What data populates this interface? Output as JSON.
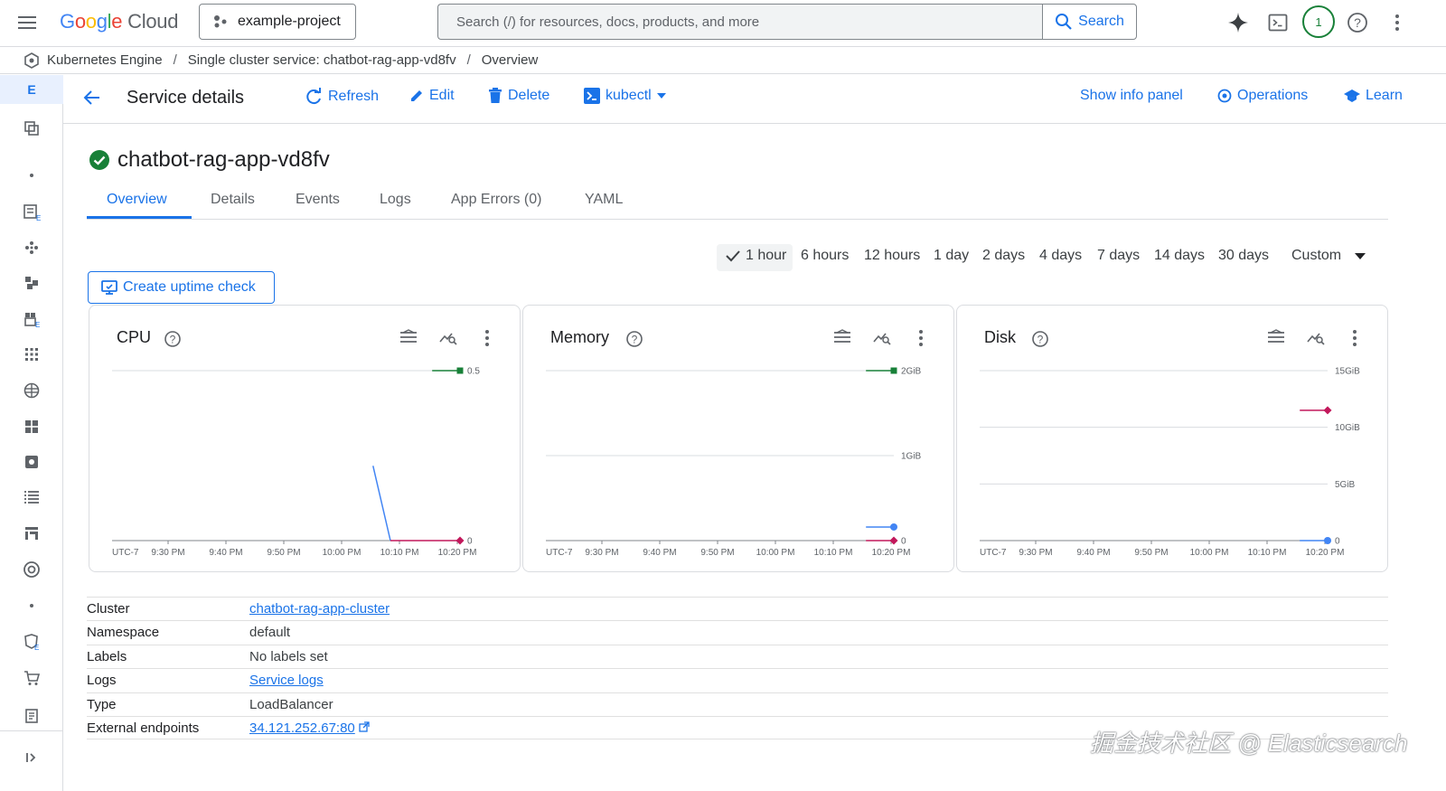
{
  "brand": {
    "logo_letters": [
      "G",
      "o",
      "o",
      "g",
      "l",
      "e"
    ],
    "product": "Cloud"
  },
  "project": {
    "name": "example-project"
  },
  "search": {
    "placeholder": "Search (/) for resources, docs, products, and more",
    "button_label": "Search"
  },
  "account": {
    "avatar_text": "1"
  },
  "breadcrumb": {
    "items": [
      "Kubernetes Engine",
      "Single cluster service:  chatbot-rag-app-vd8fv",
      "Overview"
    ],
    "separator": "/"
  },
  "rail": {
    "active_label": "E"
  },
  "actionbar": {
    "title": "Service details",
    "refresh": "Refresh",
    "edit": "Edit",
    "delete": "Delete",
    "kubectl": "kubectl",
    "show_info_panel": "Show info panel",
    "operations": "Operations",
    "learn": "Learn"
  },
  "service": {
    "name": "chatbot-rag-app-vd8fv",
    "status": "ok"
  },
  "tabs": [
    "Overview",
    "Details",
    "Events",
    "Logs",
    "App Errors (0)",
    "YAML"
  ],
  "time_range": {
    "options": [
      "1 hour",
      "6 hours",
      "12 hours",
      "1 day",
      "2 days",
      "4 days",
      "7 days",
      "14 days",
      "30 days"
    ],
    "custom": "Custom",
    "selected": "1 hour"
  },
  "uptime_button": "Create uptime check",
  "charts_meta": {
    "x_ticks": [
      "UTC-7",
      "9:30 PM",
      "9:40 PM",
      "9:50 PM",
      "10:00 PM",
      "10:10 PM",
      "10:20 PM"
    ]
  },
  "chart_data": [
    {
      "type": "line",
      "title": "CPU",
      "y_ticks": [
        "0.5",
        "0"
      ],
      "ylim": [
        0,
        0.5
      ],
      "series": [
        {
          "color": "#188038",
          "values": [
            [
              0.92,
              0.5
            ],
            [
              1.0,
              0.5
            ]
          ],
          "end_marker": "square"
        },
        {
          "color": "#4285f4",
          "values": [
            [
              0.75,
              0.22
            ],
            [
              0.8,
              0.0
            ]
          ],
          "end_marker": "none"
        },
        {
          "color": "#c2185b",
          "values": [
            [
              0.8,
              0.0
            ],
            [
              1.0,
              0.0
            ]
          ],
          "end_marker": "diamond"
        }
      ]
    },
    {
      "type": "line",
      "title": "Memory",
      "y_ticks": [
        "2GiB",
        "1GiB",
        "0"
      ],
      "ylim": [
        0,
        2
      ],
      "series": [
        {
          "color": "#188038",
          "values": [
            [
              0.92,
              2.0
            ],
            [
              1.0,
              2.0
            ]
          ],
          "end_marker": "square"
        },
        {
          "color": "#4285f4",
          "values": [
            [
              0.92,
              0.16
            ],
            [
              1.0,
              0.16
            ]
          ],
          "end_marker": "circle"
        },
        {
          "color": "#c2185b",
          "values": [
            [
              0.92,
              0.0
            ],
            [
              1.0,
              0.0
            ]
          ],
          "end_marker": "diamond"
        }
      ]
    },
    {
      "type": "line",
      "title": "Disk",
      "y_ticks": [
        "15GiB",
        "10GiB",
        "5GiB",
        "0"
      ],
      "ylim": [
        0,
        15
      ],
      "series": [
        {
          "color": "#c2185b",
          "values": [
            [
              0.92,
              11.5
            ],
            [
              1.0,
              11.5
            ]
          ],
          "end_marker": "diamond"
        },
        {
          "color": "#4285f4",
          "values": [
            [
              0.92,
              0.0
            ],
            [
              1.0,
              0.0
            ]
          ],
          "end_marker": "circle"
        }
      ]
    }
  ],
  "details": [
    {
      "label": "Cluster",
      "value": "chatbot-rag-app-cluster",
      "link": true
    },
    {
      "label": "Namespace",
      "value": "default",
      "link": false
    },
    {
      "label": "Labels",
      "value": "No labels set",
      "link": false
    },
    {
      "label": "Logs",
      "value": "Service logs",
      "link": true
    },
    {
      "label": "Type",
      "value": "LoadBalancer",
      "link": false
    },
    {
      "label": "External endpoints",
      "value": "34.121.252.67:80",
      "link": true,
      "external": true
    }
  ],
  "watermark": "掘金技术社区 @ Elasticsearch",
  "colors": {
    "accent": "#1a73e8",
    "ok": "#188038",
    "alert": "#c2185b"
  }
}
